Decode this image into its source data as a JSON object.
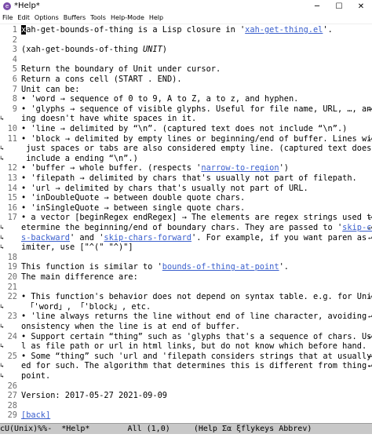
{
  "window": {
    "title": "*Help*",
    "icon": "emacs-icon",
    "min": "─",
    "max": "☐",
    "close": "✕"
  },
  "menu": [
    "File",
    "Edit",
    "Options",
    "Buffers",
    "Tools",
    "Help-Mode",
    "Help"
  ],
  "lines": [
    {
      "n": "1",
      "segs": [
        {
          "t": "x",
          "c": "cursor"
        },
        {
          "t": "ah-get-bounds-of-thing is a Lisp closure in '"
        },
        {
          "t": "xah-get-thing.el",
          "c": "link"
        },
        {
          "t": "'."
        }
      ]
    },
    {
      "n": "2",
      "segs": []
    },
    {
      "n": "3",
      "segs": [
        {
          "t": "(xah-get-bounds-of-thing "
        },
        {
          "t": "UNIT",
          "c": "it"
        },
        {
          "t": ")"
        }
      ]
    },
    {
      "n": "4",
      "segs": []
    },
    {
      "n": "5",
      "segs": [
        {
          "t": "Return the boundary of Unit under cursor."
        }
      ]
    },
    {
      "n": "6",
      "segs": [
        {
          "t": "Return a cons cell (START . END)."
        }
      ]
    },
    {
      "n": "7",
      "segs": [
        {
          "t": "Unit can be:"
        }
      ]
    },
    {
      "n": "8",
      "segs": [
        {
          "t": "• 'word → sequence of 0 to 9, A to Z, a to z, and hyphen."
        }
      ]
    },
    {
      "n": "9",
      "fr": "↵",
      "segs": [
        {
          "t": "• 'glyphs → sequence of visible glyphs. Useful for file name, URL, …, anyth"
        }
      ]
    },
    {
      "n": "",
      "fl": "↳",
      "segs": [
        {
          "t": "ing doesn't have white spaces in it."
        }
      ]
    },
    {
      "n": "10",
      "segs": [
        {
          "t": "• 'line → delimited by “\\n”. (captured text does not include “\\n”.)"
        }
      ]
    },
    {
      "n": "11",
      "fr": "↵",
      "segs": [
        {
          "t": "• 'block → delimited by empty lines or beginning/end of buffer. Lines with"
        }
      ]
    },
    {
      "n": "",
      "fl": "↳",
      "segs": [
        {
          "t": " just spaces or tabs are also considered empty line. (captured text does not"
        }
      ]
    },
    {
      "n": "",
      "fl": "↳",
      "segs": [
        {
          "t": " include a ending “\\n”.)"
        }
      ]
    },
    {
      "n": "12",
      "segs": [
        {
          "t": "• 'buffer → whole buffer. (respects '"
        },
        {
          "t": "narrow-to-region",
          "c": "link"
        },
        {
          "t": "')"
        }
      ]
    },
    {
      "n": "13",
      "segs": [
        {
          "t": "• 'filepath → delimited by chars that's usually not part of filepath."
        }
      ]
    },
    {
      "n": "14",
      "segs": [
        {
          "t": "• 'url → delimited by chars that's usually not part of URL."
        }
      ]
    },
    {
      "n": "15",
      "segs": [
        {
          "t": "• 'inDoubleQuote → between double quote chars."
        }
      ]
    },
    {
      "n": "16",
      "segs": [
        {
          "t": "• 'inSingleQuote → between single quote chars."
        }
      ]
    },
    {
      "n": "17",
      "fr": "↵",
      "segs": [
        {
          "t": "• a vector [beginRegex endRegex] → The elements are regex strings used to d"
        }
      ]
    },
    {
      "n": "",
      "fl": "↳",
      "fr": "↵",
      "segs": [
        {
          "t": "etermine the beginning/end of boundary chars. They are passed to '"
        },
        {
          "t": "skip-char",
          "c": "link"
        }
      ]
    },
    {
      "n": "",
      "fl": "↳",
      "fr": "↵",
      "segs": [
        {
          "t": "s-backward",
          "c": "link"
        },
        {
          "t": "' and '"
        },
        {
          "t": "skip-chars-forward",
          "c": "link"
        },
        {
          "t": "'. For example, if you want paren as del"
        }
      ]
    },
    {
      "n": "",
      "fl": "↳",
      "segs": [
        {
          "t": "imiter, use [\"^(\" \"^)\"]"
        }
      ]
    },
    {
      "n": "18",
      "segs": []
    },
    {
      "n": "19",
      "segs": [
        {
          "t": "This function is similar to '"
        },
        {
          "t": "bounds-of-thing-at-point",
          "c": "link"
        },
        {
          "t": "'."
        }
      ]
    },
    {
      "n": "20",
      "segs": [
        {
          "t": "The main difference are:"
        }
      ]
    },
    {
      "n": "21",
      "segs": []
    },
    {
      "n": "22",
      "fr": "↵",
      "segs": [
        {
          "t": "• This function's behavior does not depend on syntax table. e.g. for Units"
        }
      ]
    },
    {
      "n": "",
      "fl": "↳",
      "segs": [
        {
          "t": " 「'word」, 「'block」, etc."
        }
      ]
    },
    {
      "n": "23",
      "fr": "↵",
      "segs": [
        {
          "t": "• 'line always returns the line without end of line character, avoiding inc"
        }
      ]
    },
    {
      "n": "",
      "fl": "↳",
      "segs": [
        {
          "t": "onsistency when the line is at end of buffer."
        }
      ]
    },
    {
      "n": "24",
      "fr": "↵",
      "segs": [
        {
          "t": "• Support certain “thing” such as 'glyphs that's a sequence of chars. Usefu"
        }
      ]
    },
    {
      "n": "",
      "fl": "↳",
      "segs": [
        {
          "t": "l as file path or url in html links, but do not know which before hand."
        }
      ]
    },
    {
      "n": "25",
      "fr": "↵",
      "segs": [
        {
          "t": "• Some “thing” such 'url and 'filepath considers strings that at usually us"
        }
      ]
    },
    {
      "n": "",
      "fl": "↳",
      "fr": "↵",
      "segs": [
        {
          "t": "ed for such. The algorithm that determines this is different from thing-at-"
        }
      ]
    },
    {
      "n": "",
      "fl": "↳",
      "segs": [
        {
          "t": "point."
        }
      ]
    },
    {
      "n": "26",
      "segs": []
    },
    {
      "n": "27",
      "segs": [
        {
          "t": "Version: 2017-05-27 2021-09-09"
        }
      ]
    },
    {
      "n": "28",
      "segs": []
    },
    {
      "n": "29",
      "segs": [
        {
          "t": "[back]",
          "c": "link"
        }
      ]
    }
  ],
  "modeline": "cU(Unix)%%-  *Help*        All (1,0)     (Help Σα ξflykeys Abbrev)"
}
